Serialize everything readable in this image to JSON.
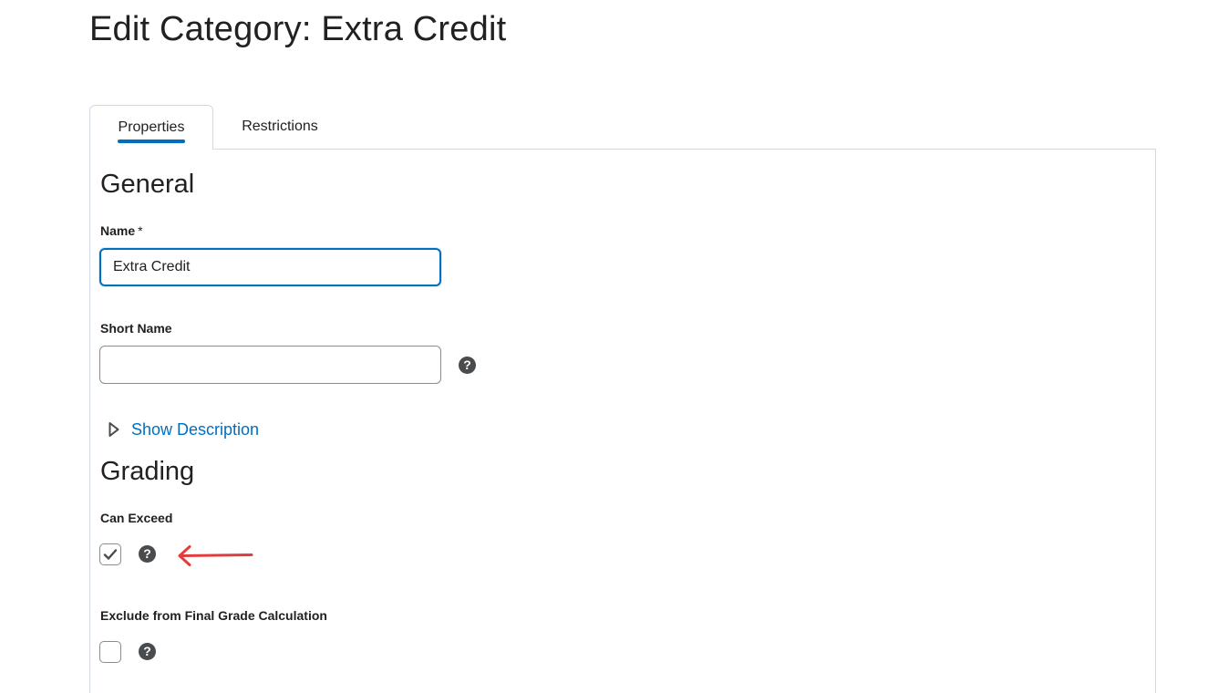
{
  "page": {
    "title": "Edit Category: Extra Credit"
  },
  "tabs": [
    {
      "label": "Properties",
      "selected": true
    },
    {
      "label": "Restrictions",
      "selected": false
    }
  ],
  "general": {
    "heading": "General",
    "name_label": "Name",
    "name_required_marker": "*",
    "name_value": "Extra Credit",
    "short_name_label": "Short Name",
    "short_name_value": "",
    "show_description_label": "Show Description"
  },
  "grading": {
    "heading": "Grading",
    "can_exceed_label": "Can Exceed",
    "can_exceed_checked": true,
    "exclude_label": "Exclude from Final Grade Calculation",
    "exclude_checked": false
  },
  "icons": {
    "help": "question-circle-icon",
    "expand": "triangle-right-icon",
    "check": "checkmark-icon",
    "annotation": "left-arrow-icon"
  },
  "colors": {
    "accent": "#006fbf",
    "text": "#202122",
    "help_icon": "#494c4e",
    "annotation_arrow": "#e03e3e",
    "border": "#d3d9e3"
  }
}
